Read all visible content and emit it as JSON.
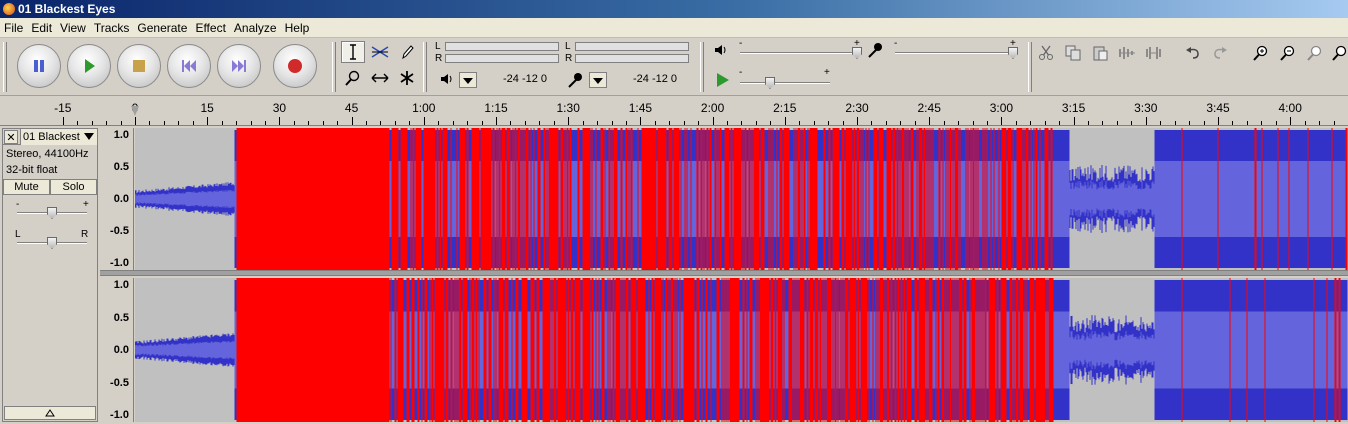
{
  "window": {
    "title": "01 Blackest Eyes",
    "app_icon": "audacity-icon"
  },
  "menu": [
    "File",
    "Edit",
    "View",
    "Tracks",
    "Generate",
    "Effect",
    "Analyze",
    "Help"
  ],
  "transport": [
    {
      "name": "pause-button",
      "icon": "pause-icon",
      "color": "#4a5fd0"
    },
    {
      "name": "play-button",
      "icon": "play-icon",
      "color": "#2e9a2e"
    },
    {
      "name": "stop-button",
      "icon": "stop-icon",
      "color": "#c8a24a"
    },
    {
      "name": "skip-start-button",
      "icon": "skip-start-icon",
      "color": "#8a7ad6"
    },
    {
      "name": "skip-end-button",
      "icon": "skip-end-icon",
      "color": "#8a7ad6"
    },
    {
      "name": "record-button",
      "icon": "record-icon",
      "color": "#d02a2a"
    }
  ],
  "meters": {
    "play": {
      "l": "L",
      "r": "R",
      "scale": "-24  -12   0"
    },
    "record": {
      "l": "L",
      "r": "R",
      "scale": "-24  -12   0"
    }
  },
  "ruler": {
    "labels": [
      "-15",
      "0",
      "15",
      "30",
      "45",
      "1:00",
      "1:15",
      "1:30",
      "1:45",
      "2:00",
      "2:15",
      "2:30",
      "2:45",
      "3:00",
      "3:15",
      "3:30",
      "3:45",
      "4:00"
    ]
  },
  "track": {
    "name": "01 Blackest",
    "format": "Stereo, 44100Hz",
    "bit_depth": "32-bit float",
    "mute_label": "Mute",
    "solo_label": "Solo",
    "gain_minus": "-",
    "gain_plus": "+",
    "pan_left": "L",
    "pan_right": "R"
  },
  "vruler_labels": [
    "1.0",
    "0.5",
    "0.0",
    "-0.5",
    "-1.0"
  ],
  "colors": {
    "waveform": "#3232c8",
    "waveform_rms": "#6464dc",
    "clipping": "#ff0000",
    "background": "#c0c0c0"
  }
}
